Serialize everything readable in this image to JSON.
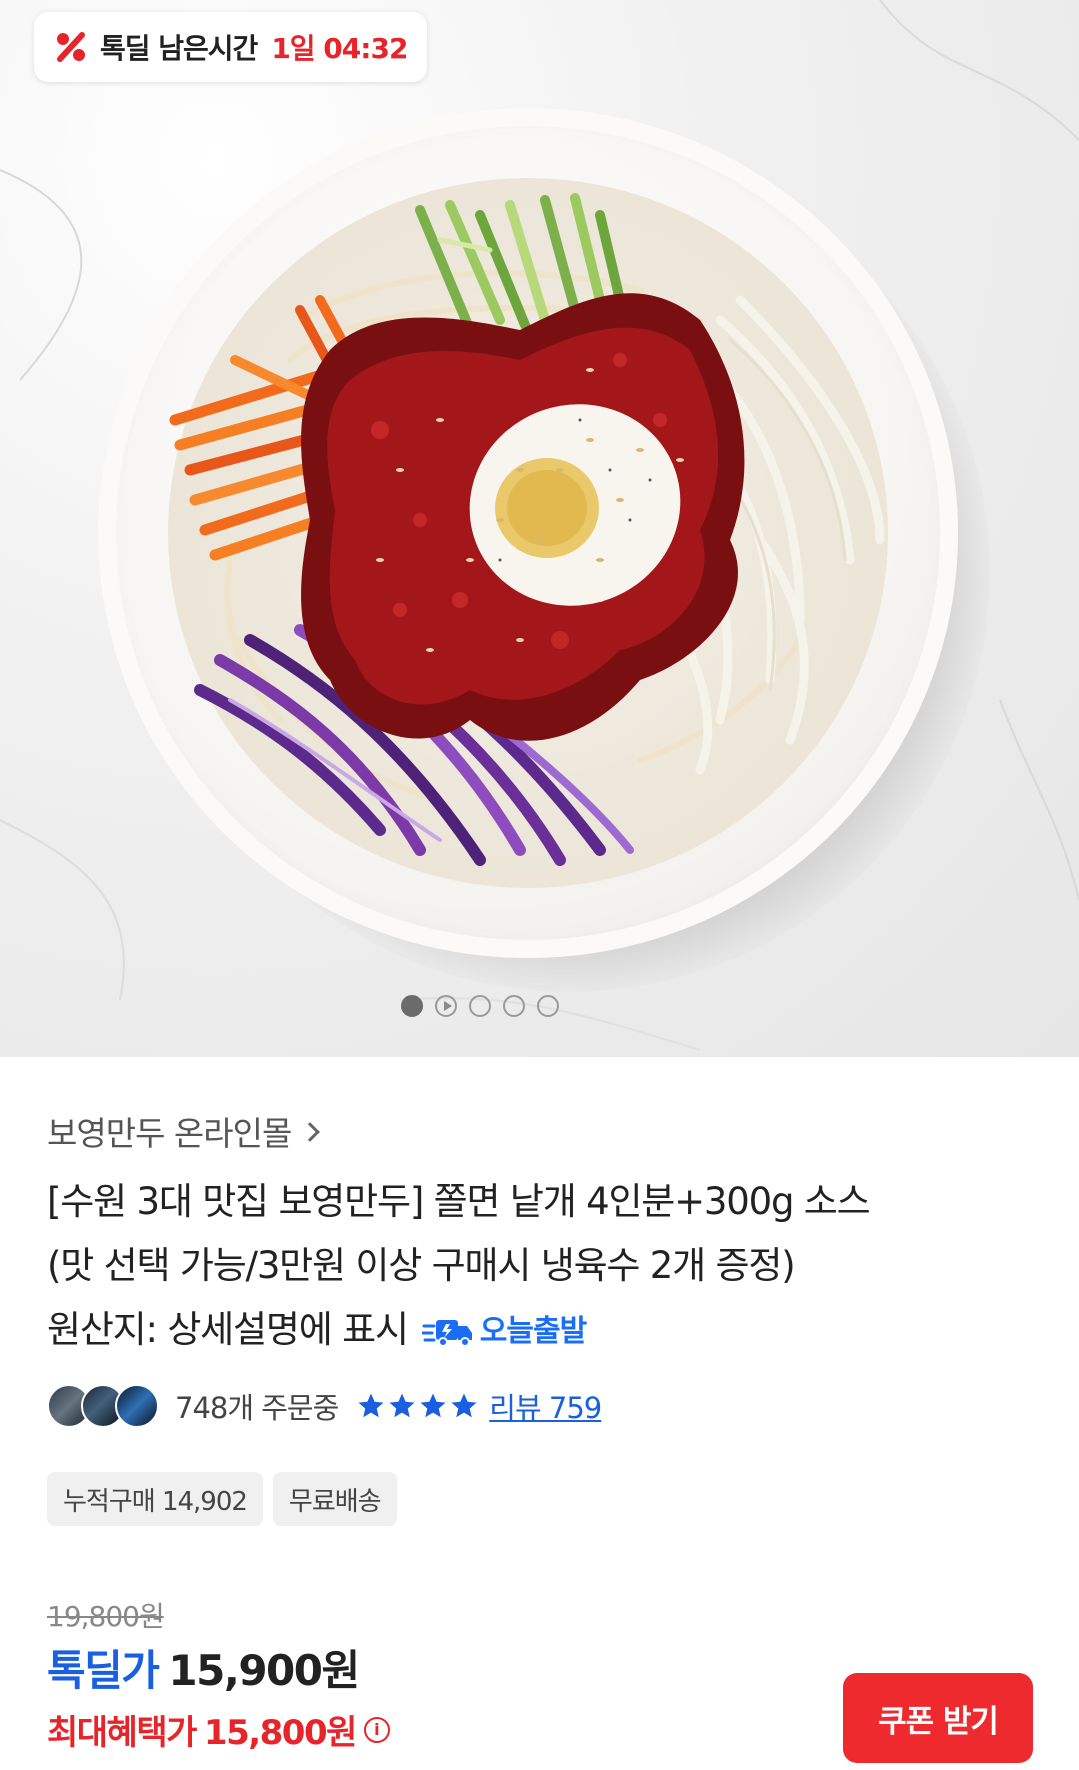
{
  "deal_timer": {
    "label": "톡딜 남은시간",
    "remaining": "1일 04:32",
    "icon": "percent-icon",
    "accent_color": "#e8242b"
  },
  "carousel": {
    "image_subject": "jjolmyeon-bowl",
    "page_count": 5,
    "active_index": 0,
    "has_video_dot": true
  },
  "store": {
    "name": "보영만두 온라인몰"
  },
  "product": {
    "title_line1": "[수원 3대 맛집 보영만두] 쫄면 낱개 4인분+300g 소스",
    "title_line2": "(맛 선택 가능/3만원 이상 구매시 냉육수 2개 증정)",
    "title_line3": "원산지: 상세설명에 표시",
    "badge_today": "오늘출발"
  },
  "social_proof": {
    "orders": "748개 주문중",
    "stars_count": 4,
    "review": "리뷰 759",
    "star_color": "#1a5fe0"
  },
  "chips": [
    "누적구매 14,902",
    "무료배송"
  ],
  "pricing": {
    "original": "19,800원",
    "deal_label": "톡딜가",
    "deal_price": "15,900원",
    "max_label": "최대혜택가",
    "max_price": "15,800원"
  },
  "actions": {
    "coupon": "쿠폰 받기",
    "coupon_color": "#ee2a2f"
  }
}
